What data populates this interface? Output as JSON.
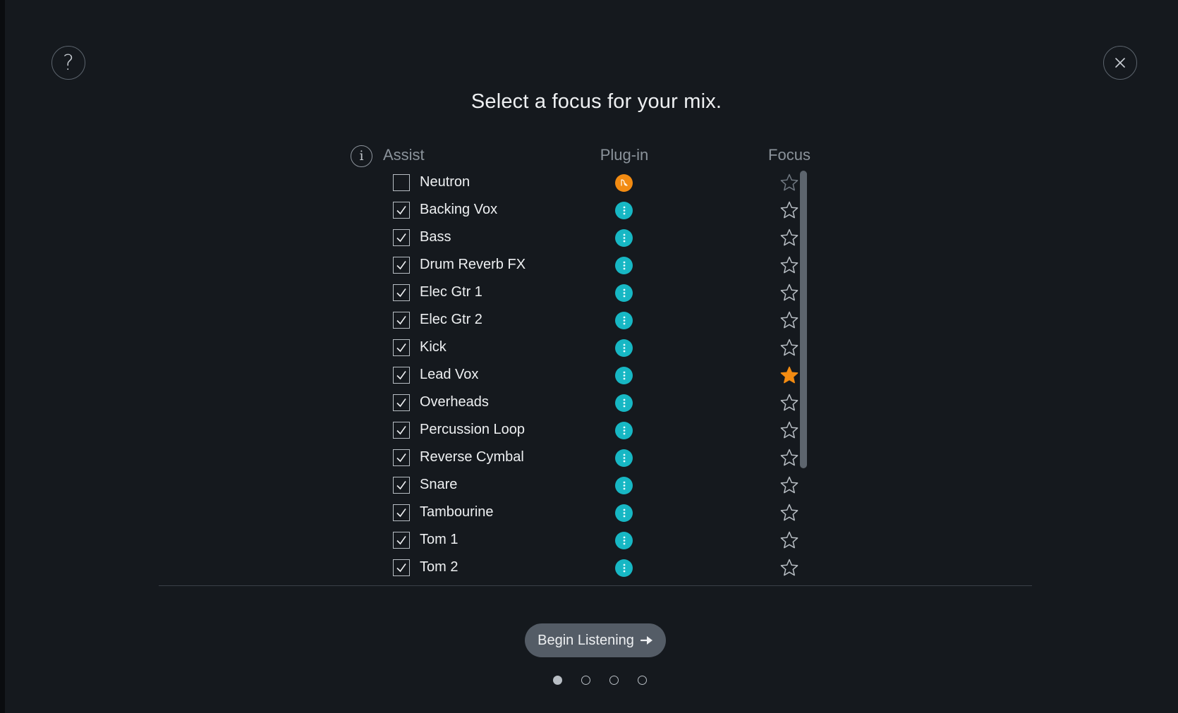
{
  "dialog": {
    "title": "Select a focus for your mix.",
    "help_icon": "question-mark-icon",
    "close_icon": "close-x-icon"
  },
  "columns": {
    "assist": "Assist",
    "plugin": "Plug-in",
    "focus": "Focus",
    "info_icon": "info-icon"
  },
  "colors": {
    "background": "#15191e",
    "plugin_teal": "#17b7c4",
    "neutron_orange": "#f28b12",
    "focus_star_active": "#f28b12",
    "button_gray": "#545c66"
  },
  "tracks": [
    {
      "name": "Neutron",
      "assist_checked": false,
      "plugin": "neutron",
      "focus": false
    },
    {
      "name": "Backing Vox",
      "assist_checked": true,
      "plugin": "relay",
      "focus": false
    },
    {
      "name": "Bass",
      "assist_checked": true,
      "plugin": "relay",
      "focus": false
    },
    {
      "name": "Drum Reverb FX",
      "assist_checked": true,
      "plugin": "relay",
      "focus": false
    },
    {
      "name": "Elec Gtr 1",
      "assist_checked": true,
      "plugin": "relay",
      "focus": false
    },
    {
      "name": "Elec Gtr 2",
      "assist_checked": true,
      "plugin": "relay",
      "focus": false
    },
    {
      "name": "Kick",
      "assist_checked": true,
      "plugin": "relay",
      "focus": false
    },
    {
      "name": "Lead Vox",
      "assist_checked": true,
      "plugin": "relay",
      "focus": true
    },
    {
      "name": "Overheads",
      "assist_checked": true,
      "plugin": "relay",
      "focus": false
    },
    {
      "name": "Percussion Loop",
      "assist_checked": true,
      "plugin": "relay",
      "focus": false
    },
    {
      "name": "Reverse Cymbal",
      "assist_checked": true,
      "plugin": "relay",
      "focus": false
    },
    {
      "name": "Snare",
      "assist_checked": true,
      "plugin": "relay",
      "focus": false
    },
    {
      "name": "Tambourine",
      "assist_checked": true,
      "plugin": "relay",
      "focus": false
    },
    {
      "name": "Tom 1",
      "assist_checked": true,
      "plugin": "relay",
      "focus": false
    },
    {
      "name": "Tom 2",
      "assist_checked": true,
      "plugin": "relay",
      "focus": false
    }
  ],
  "footer": {
    "begin_label": "Begin Listening",
    "begin_icon": "arrow-right-icon",
    "pages": 4,
    "current_page": 1
  }
}
